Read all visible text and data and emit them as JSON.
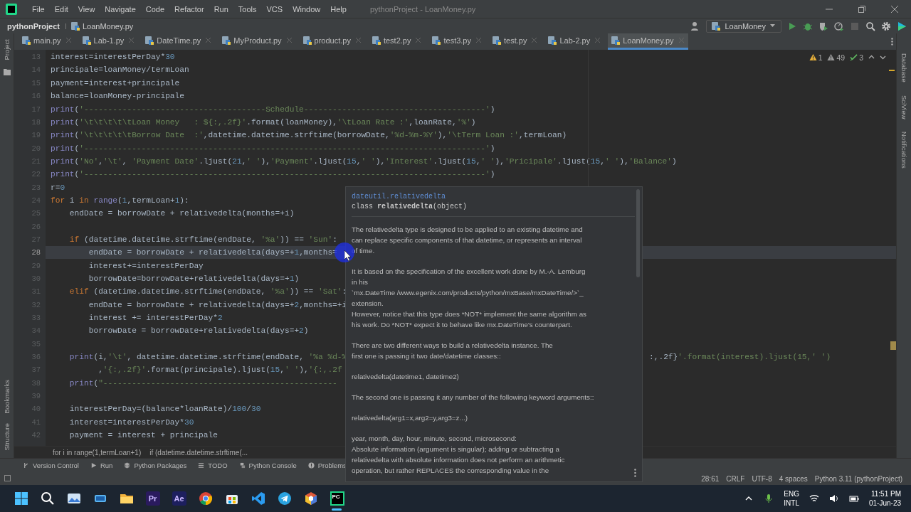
{
  "window": {
    "title": "pythonProject - LoanMoney.py"
  },
  "menu": [
    "File",
    "Edit",
    "View",
    "Navigate",
    "Code",
    "Refactor",
    "Run",
    "Tools",
    "VCS",
    "Window",
    "Help"
  ],
  "breadcrumb": {
    "project": "pythonProject",
    "file": "LoanMoney.py"
  },
  "run_config": "LoanMoney",
  "tabs": [
    {
      "label": "main.py",
      "selected": false
    },
    {
      "label": "Lab-1.py",
      "selected": false
    },
    {
      "label": "DateTime.py",
      "selected": false
    },
    {
      "label": "MyProduct.py",
      "selected": false
    },
    {
      "label": "product.py",
      "selected": false
    },
    {
      "label": "test2.py",
      "selected": false
    },
    {
      "label": "test3.py",
      "selected": false
    },
    {
      "label": "test.py",
      "selected": false
    },
    {
      "label": "Lab-2.py",
      "selected": false
    },
    {
      "label": "LoanMoney.py",
      "selected": true
    }
  ],
  "inspections": [
    {
      "kind": "error",
      "count": "1"
    },
    {
      "kind": "warning",
      "count": "49"
    },
    {
      "kind": "typo",
      "count": "3"
    }
  ],
  "left_tool_windows_top": [
    "Project"
  ],
  "left_tool_windows_bottom": [
    "Bookmarks",
    "Structure"
  ],
  "right_tool_windows": [
    "Database",
    "SciView",
    "Notifications"
  ],
  "code_lines": [
    {
      "number": "13",
      "code": "interest=interestPerDay*30",
      "current": false
    },
    {
      "number": "14",
      "code": "principale=loanMoney/termLoan",
      "current": false
    },
    {
      "number": "15",
      "code": "payment=interest+principale",
      "current": false
    },
    {
      "number": "16",
      "code": "balance=loanMoney-principale",
      "current": false
    },
    {
      "number": "17",
      "code": "print('--------------------------------------Schedule--------------------------------------')",
      "current": false
    },
    {
      "number": "18",
      "code": "print('\\t\\t\\t\\t\\tLoan Money   : ${:,.2f}'.format(loanMoney),'\\tLoan Rate :',loanRate,'%')",
      "current": false
    },
    {
      "number": "19",
      "code": "print('\\t\\t\\t\\t\\tBorrow Date  :',datetime.datetime.strftime(borrowDate,'%d-%m-%Y'),'\\tTerm Loan :',termLoan)",
      "current": false
    },
    {
      "number": "20",
      "code": "print('------------------------------------------------------------------------------------')",
      "current": false
    },
    {
      "number": "21",
      "code": "print('No','\\t', 'Payment Date'.ljust(21,' '),'Payment'.ljust(15,' '),'Interest'.ljust(15,' '),'Pricipale'.ljust(15,' '),'Balance')",
      "current": false
    },
    {
      "number": "22",
      "code": "print('------------------------------------------------------------------------------------')",
      "current": false
    },
    {
      "number": "23",
      "code": "r=0",
      "current": false
    },
    {
      "number": "24",
      "code": "for i in range(1,termLoan+1):",
      "current": false
    },
    {
      "number": "25",
      "code": "    endDate = borrowDate + relativedelta(months=+i)",
      "current": false
    },
    {
      "number": "26",
      "current": false
    },
    {
      "number": "27",
      "code": "    if (datetime.datetime.strftime(endDate, '%a')) == 'Sun':",
      "current": false
    },
    {
      "number": "28",
      "code": "        endDate = borrowDate + relativedelta(days=+1,months=",
      "current": true
    },
    {
      "number": "29",
      "code": "        interest+=interestPerDay",
      "current": false
    },
    {
      "number": "30",
      "code": "        borrowDate=borrowDate+relativedelta(days=+1)",
      "current": false
    },
    {
      "number": "31",
      "code": "    elif (datetime.datetime.strftime(endDate, '%a')) == 'Sat':",
      "current": false
    },
    {
      "number": "32",
      "code": "        endDate = borrowDate + relativedelta(days=+2,months=+i",
      "current": false
    },
    {
      "number": "33",
      "code": "        interest += interestPerDay*2",
      "current": false
    },
    {
      "number": "34",
      "code": "        borrowDate = borrowDate+relativedelta(days=+2)",
      "current": false
    },
    {
      "number": "35",
      "current": false
    },
    {
      "number": "36",
      "code": "    print(i,'\\t', datetime.datetime.strftime(endDate, '%a %d-%",
      "tail": ":,.2f}'.format(interest).ljust(15,' ')",
      "current": false
    },
    {
      "number": "37",
      "code": "          ,'{:,.2f}'.format(principale).ljust(15,' '),'{:,.2f",
      "current": false
    },
    {
      "number": "38",
      "code": "    print(\"-------------------------------------------------",
      "current": false
    },
    {
      "number": "39",
      "current": false
    },
    {
      "number": "40",
      "code": "    interestPerDay=(balance*loanRate)/100/30",
      "current": false
    },
    {
      "number": "41",
      "code": "    interest=interestPerDay*30",
      "current": false
    },
    {
      "number": "42",
      "code": "    payment = interest + principale",
      "current": false
    }
  ],
  "doc_popup": {
    "module": "dateutil.relativedelta",
    "signature": "class **relativedelta**(object)",
    "paragraphs": [
      "The relativedelta type is designed to be applied to an existing datetime and\ncan replace specific components of that datetime, or represents an interval\nof time.",
      "It is based on the specification of the excellent work done by M.-A. Lemburg\nin his\n`mx.DateTime /www.egenix.com/products/python/mxBase/mxDateTime/>`_\nextension.\nHowever, notice that this type does *NOT* implement the same algorithm as\nhis work. Do *NOT* expect it to behave like mx.DateTime's counterpart.",
      "There are two different ways to build a relativedelta instance. The\nfirst one is passing it two date/datetime classes::",
      "relativedelta(datetime1, datetime2)",
      "The second one is passing it any number of the following keyword arguments::",
      "relativedelta(arg1=x,arg2=y,arg3=z...)",
      "year, month, day, hour, minute, second, microsecond:\nAbsolute information (argument is singular); adding or subtracting a\nrelativedelta with absolute information does not perform an arithmetic\noperation, but rather REPLACES the corresponding value in the"
    ]
  },
  "code_breadcrumbs": [
    "for i in range(1,termLoan+1)",
    "if (datetime.datetime.strftime(..."
  ],
  "tool_buttons": [
    {
      "label": "Version Control",
      "kind": "vcs"
    },
    {
      "label": "Run",
      "kind": "run"
    },
    {
      "label": "Python Packages",
      "kind": "packages"
    },
    {
      "label": "TODO",
      "kind": "todo"
    },
    {
      "label": "Python Console",
      "kind": "console"
    },
    {
      "label": "Problems",
      "kind": "problems"
    }
  ],
  "status": [
    "28:61",
    "CRLF",
    "UTF-8",
    "4 spaces",
    "Python 3.11 (pythonProject)"
  ],
  "taskbar": {
    "apps": [
      {
        "kind": "start",
        "active": false
      },
      {
        "kind": "search",
        "active": false
      },
      {
        "kind": "photos",
        "active": false
      },
      {
        "kind": "tablet",
        "active": false
      },
      {
        "kind": "folder",
        "active": false
      },
      {
        "kind": "letters",
        "label": "Pr",
        "color": "#2a1a5e",
        "active": false
      },
      {
        "kind": "letters",
        "label": "Ae",
        "color": "#1d1f5e",
        "active": false
      },
      {
        "kind": "chrome",
        "active": false
      },
      {
        "kind": "store",
        "active": false
      },
      {
        "kind": "vscode",
        "active": false
      },
      {
        "kind": "telegram",
        "active": false
      },
      {
        "kind": "cube",
        "active": false
      },
      {
        "kind": "pycharm",
        "label": "PC",
        "active": true
      }
    ],
    "language": [
      "ENG",
      "INTL"
    ],
    "time": "11:51 PM",
    "date": "01-Jun-23"
  }
}
